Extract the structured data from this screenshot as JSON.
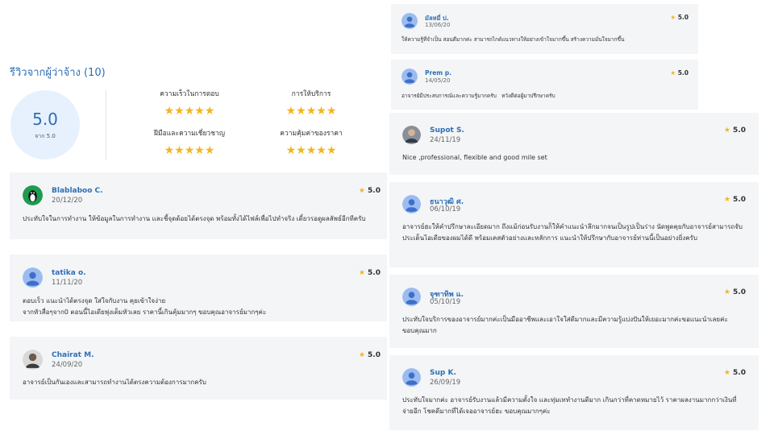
{
  "summary": {
    "title": "รีวิวจากผู้ว่าจ้าง (10)",
    "score": "5.0",
    "score_sub": "จาก 5.0",
    "categories": [
      {
        "label": "ความเร็วในการตอบ",
        "stars": "★★★★★"
      },
      {
        "label": "การให้บริการ",
        "stars": "★★★★★"
      },
      {
        "label": "ฝีมือและความเชี่ยวชาญ",
        "stars": "★★★★★"
      },
      {
        "label": "ความคุ้มค่าของราคา",
        "stars": "★★★★★"
      }
    ]
  },
  "reviews": [
    {
      "name": "Blablaboo C.",
      "date": "20/12/20",
      "rating": "5.0",
      "star": "★",
      "text": "ประทับใจในการทำงาน ให้ข้อมูลในการทำงาน และชี้จุดด้อยได้ตรงจุด พร้อมทั้งได้ไฟล์เพื่อไปทำจริง เดี๋ยวรอดูผลลัพธ์อีกทีครับ",
      "avatar": "penguin-avatar"
    },
    {
      "name": "tatika o.",
      "date": "11/11/20",
      "rating": "5.0",
      "star": "★",
      "text": "ตอบเร็ว แนะนำได้ตรงจุด ใส่ใจกับงาน คุยเข้าใจง่าย\nจากหัวสื่อๆจาก0 ตอนนี้ไอเดียพุ่งเต็มหัวเลย ราคานี้เกินคุ้มมากๆ ขอบคุณอาจารย์มากๆค่ะ",
      "avatar": "default-avatar"
    },
    {
      "name": "Chairat M.",
      "date": "24/09/20",
      "rating": "5.0",
      "star": "★",
      "text": "อาจารย์เป็นกันเองและสามารถทำงานได้ตรงความต้องการมากครับ",
      "avatar": "photo-avatar"
    },
    {
      "name": "มัลหมี่ ป.",
      "date": "13/06/20",
      "rating": "5.0",
      "star": "★",
      "text": "ให้ความรู้ที่จำเป็น สอนดีมากค่ะ สามารถไกด์แนวทางให้อย่างเข้าใจมากขึ้น สร้างความมั่นใจมากขึ้น",
      "avatar": "default-avatar"
    },
    {
      "name": "Prem p.",
      "date": "14/05/20",
      "rating": "5.0",
      "star": "★",
      "text": "อาจารย์มีประสบการณ์และความรู้มากครับ   หวังดีต่อผู้มาปรึกษาครับ",
      "avatar": "default-avatar"
    },
    {
      "name": "Supot S.",
      "date": "24/11/19",
      "rating": "5.0",
      "star": "★",
      "text": "Nice ,professional, flexible and good mile set",
      "avatar": "photo-avatar"
    },
    {
      "name": "ธนาวุฒิ ศ.",
      "date": "06/10/19",
      "rating": "5.0",
      "star": "★",
      "text": "อาจารย์ฮะให้คำปรึกษาละเอียดมาก ถึงแม้ก่อนรับงานก็ให้คำแนะนำลึกมากจนเป็นรูปเป็นร่าง นัดพูดคุยกับอาจารย์สามารถจับประเด็นไอเดียของผมได้ดี พร้อมเคสตัวอย่างและหลักการ แนะนำให้ปรึกษากับอาจารย์ท่านนี้เป็นอย่างยิ่งครับ",
      "avatar": "default-avatar"
    },
    {
      "name": "จุฑาทิพ แ.",
      "date": "05/10/19",
      "rating": "5.0",
      "star": "★",
      "text": "ประทับใจบริการของอาจารย์มากค่ะเป็นมืออาชีพและเอาใจใส่ดีมากและมีความรู้แบ่งปันให้เยอะมากค่ะขอแนะนำเลยค่ะขอบคุณมาก",
      "avatar": "default-avatar"
    },
    {
      "name": "Sup K.",
      "date": "26/09/19",
      "rating": "5.0",
      "star": "★",
      "text": "ประทับใจมากค่ะ  อาจารย์รับงานแล้วมีความตั้งใจ และทุ่มเททำงานดีมาก เกินกว่าที่คาดหมายไว้ ราคาผลงานมากกว่าเงินที่จ่ายอีก โชคดีมากที่ได้เจออาจารย์ฮะ ขอบคุณมากๆค่ะ",
      "avatar": "default-avatar"
    }
  ]
}
